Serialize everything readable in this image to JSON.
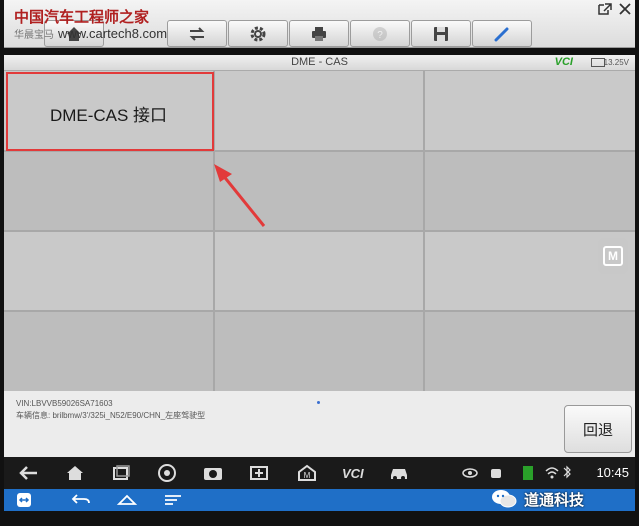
{
  "watermark": {
    "title": "中国汽车工程师之家",
    "subtitle": "华晨宝马",
    "url": "www.cartech8.com"
  },
  "toolbar": {
    "buttons": [
      {
        "name": "home-icon"
      },
      {
        "name": "vehicle-swap-icon"
      },
      {
        "name": "gear-icon"
      },
      {
        "name": "printer-icon"
      },
      {
        "name": "help-icon"
      },
      {
        "name": "save-icon"
      },
      {
        "name": "pen-icon"
      }
    ]
  },
  "statusbar": {
    "title": "DME - CAS",
    "vci": "VCI",
    "voltage": "13.25V"
  },
  "grid": {
    "cells": [
      {
        "label": "DME-CAS 接口"
      }
    ]
  },
  "side_button": {
    "label": "M"
  },
  "info": {
    "vin": "VIN:LBVVB59026SA71603",
    "vehicle": "车辆信息: brilbmw/3'/325i_N52/E90/CHN_左座驾驶型"
  },
  "back_button": {
    "label": "回退"
  },
  "system_bar": {
    "time": "10:45"
  },
  "wechat": {
    "name": "道通科技"
  },
  "colors": {
    "highlight": "#e23a3a",
    "bluebar": "#1f6fc7",
    "vci_accent": "#2aa02a"
  }
}
